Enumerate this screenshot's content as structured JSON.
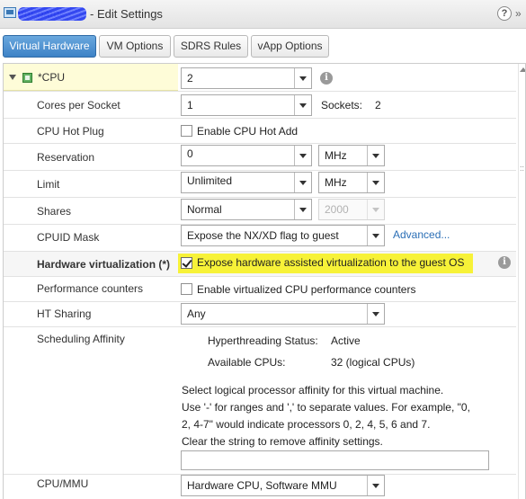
{
  "window": {
    "vm_name": "vm-name",
    "title": "- Edit Settings",
    "help_label": "?",
    "more_label": "»"
  },
  "tabs": [
    {
      "label": "Virtual Hardware"
    },
    {
      "label": "VM Options"
    },
    {
      "label": "SDRS Rules"
    },
    {
      "label": "vApp Options"
    }
  ],
  "cpu": {
    "label": "*CPU",
    "value": "2",
    "info_icon": "info-icon"
  },
  "cores_per_socket": {
    "label": "Cores per Socket",
    "value": "1",
    "sockets_label": "Sockets:",
    "sockets_value": "2"
  },
  "cpu_hot_plug": {
    "label": "CPU Hot Plug",
    "checkbox_label": "Enable CPU Hot Add",
    "checked": false
  },
  "reservation": {
    "label": "Reservation",
    "value": "0",
    "unit": "MHz"
  },
  "limit": {
    "label": "Limit",
    "value": "Unlimited",
    "unit": "MHz"
  },
  "shares": {
    "label": "Shares",
    "value": "Normal",
    "amount": "2000"
  },
  "cpuid_mask": {
    "label": "CPUID Mask",
    "value": "Expose the NX/XD flag to guest",
    "advanced_link": "Advanced..."
  },
  "hardware_virtualization": {
    "label": "Hardware virtualization (*)",
    "checkbox_label": "Expose hardware assisted virtualization to the guest OS",
    "checked": true,
    "highlight_color": "#f7f238"
  },
  "performance_counters": {
    "label": "Performance counters",
    "checkbox_label": "Enable virtualized CPU performance counters",
    "checked": false
  },
  "ht_sharing": {
    "label": "HT Sharing",
    "value": "Any"
  },
  "scheduling_affinity": {
    "label": "Scheduling Affinity",
    "ht_status_label": "Hyperthreading Status:",
    "ht_status_value": "Active",
    "cpus_label": "Available CPUs:",
    "cpus_value": "32 (logical CPUs)",
    "help_line1": "Select logical processor affinity for this virtual machine.",
    "help_line2": "Use '-' for ranges and ',' to separate values. For example, \"0,",
    "help_line3": "2, 4-7\" would indicate processors 0, 2, 4, 5, 6 and 7.",
    "help_line4": "Clear the string to remove affinity settings.",
    "input_value": ""
  },
  "cpu_mmu": {
    "label": "CPU/MMU",
    "value": "Hardware CPU, Software MMU"
  },
  "colors": {
    "accent": "#3d82c6",
    "link": "#2b6fb6",
    "cpu_row_bg": "#fefcd8"
  }
}
